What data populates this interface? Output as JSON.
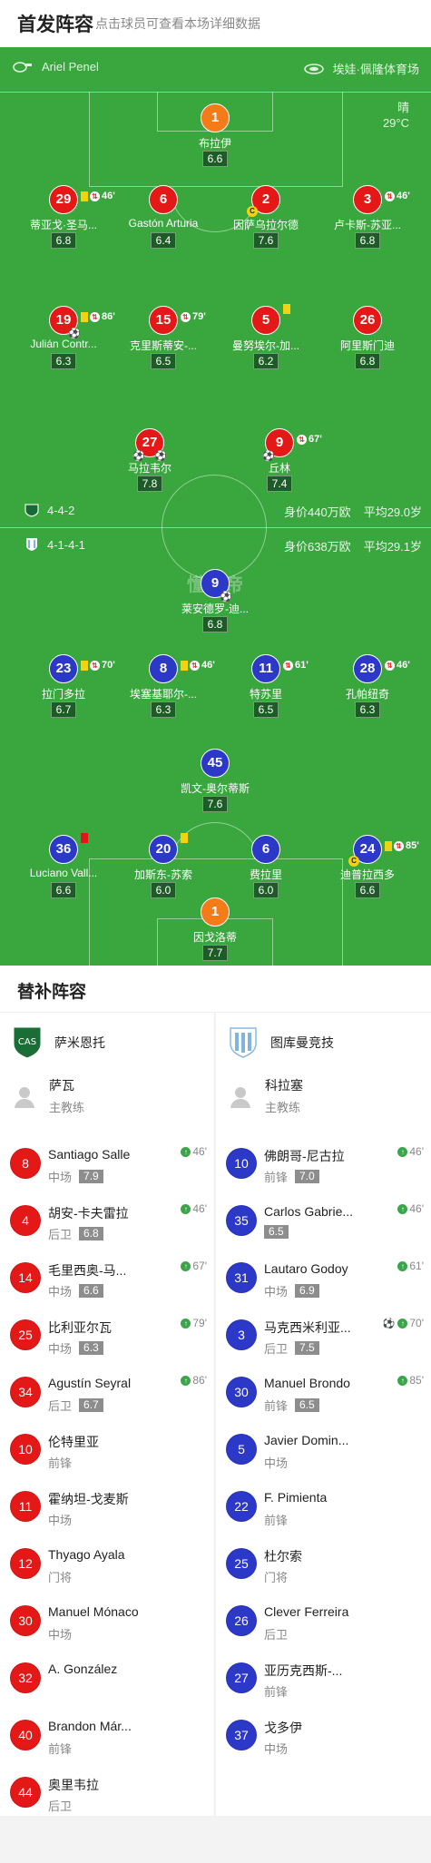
{
  "header": {
    "title": "首发阵容",
    "subtitle": "点击球员可查看本场详细数据"
  },
  "match": {
    "referee": "Ariel Penel",
    "stadium": "埃娃·佩隆体育场",
    "weather": "晴",
    "temperature": "29°C",
    "watermark": "懂球帝"
  },
  "home": {
    "formation": "4-4-2",
    "value": "身价440万欧",
    "age": "平均29.0岁",
    "players": [
      {
        "num": "1",
        "name": "布拉伊",
        "rating": "6.6",
        "color": "org"
      },
      {
        "num": "29",
        "name": "蒂亚戈·圣马...",
        "rating": "6.8",
        "color": "red",
        "yc": true,
        "sub": "46'"
      },
      {
        "num": "6",
        "name": "Gastón Arturia",
        "rating": "6.4",
        "color": "red"
      },
      {
        "num": "2",
        "name": "因萨乌拉尔德",
        "rating": "7.6",
        "color": "red",
        "cap": true
      },
      {
        "num": "3",
        "name": "卢卡斯-苏亚...",
        "rating": "6.8",
        "color": "red",
        "sub": "46'"
      },
      {
        "num": "19",
        "name": "Julián Contr...",
        "rating": "6.3",
        "color": "red",
        "yc": true,
        "sub": "86'",
        "ball2": true
      },
      {
        "num": "15",
        "name": "克里斯蒂安-...",
        "rating": "6.5",
        "color": "red",
        "sub": "79'"
      },
      {
        "num": "5",
        "name": "曼努埃尔-加...",
        "rating": "6.2",
        "color": "red",
        "yc": true
      },
      {
        "num": "26",
        "name": "阿里斯门迪",
        "rating": "6.8",
        "color": "red"
      },
      {
        "num": "27",
        "name": "马拉韦尔",
        "rating": "7.8",
        "color": "red",
        "goals": "⚽",
        "ball2": true
      },
      {
        "num": "9",
        "name": "丘林",
        "rating": "7.4",
        "color": "red",
        "sub": "67'",
        "goals": "⚽"
      }
    ]
  },
  "away": {
    "formation": "4-1-4-1",
    "value": "身价638万欧",
    "age": "平均29.1岁",
    "players": [
      {
        "num": "9",
        "name": "莱安德罗-迪...",
        "rating": "6.8",
        "color": "blu",
        "ball2": true
      },
      {
        "num": "23",
        "name": "拉门多拉",
        "rating": "6.7",
        "color": "blu",
        "yc": true,
        "sub": "70'"
      },
      {
        "num": "8",
        "name": "埃塞基耶尔-...",
        "rating": "6.3",
        "color": "blu",
        "yc": true,
        "sub": "46'"
      },
      {
        "num": "11",
        "name": "特苏里",
        "rating": "6.5",
        "color": "blu",
        "sub": "61'"
      },
      {
        "num": "28",
        "name": "孔帕纽奇",
        "rating": "6.3",
        "color": "blu",
        "sub": "46'"
      },
      {
        "num": "45",
        "name": "凯文-奥尔蒂斯",
        "rating": "7.6",
        "color": "blu"
      },
      {
        "num": "36",
        "name": "Luciano Vall...",
        "rating": "6.6",
        "color": "blu",
        "rc": true
      },
      {
        "num": "20",
        "name": "加斯东-苏索",
        "rating": "6.0",
        "color": "blu",
        "yc": true
      },
      {
        "num": "6",
        "name": "费拉里",
        "rating": "6.0",
        "color": "blu"
      },
      {
        "num": "24",
        "name": "迪普拉西多",
        "rating": "6.6",
        "color": "blu",
        "yc": true,
        "sub": "85'",
        "cap": true
      },
      {
        "num": "1",
        "name": "因戈洛蒂",
        "rating": "7.7",
        "color": "org"
      }
    ]
  },
  "subs": {
    "title": "替补阵容",
    "home": {
      "team": "萨米恩托",
      "coach": "萨瓦",
      "coach_role": "主教练",
      "players": [
        {
          "num": "8",
          "name": "Santiago Salle",
          "pos": "中场",
          "rating": "7.9",
          "min": "46'"
        },
        {
          "num": "4",
          "name": "胡安-卡夫雷拉",
          "pos": "后卫",
          "rating": "6.8",
          "min": "46'"
        },
        {
          "num": "14",
          "name": "毛里西奥-马...",
          "pos": "中场",
          "rating": "6.6",
          "min": "67'"
        },
        {
          "num": "25",
          "name": "比利亚尔瓦",
          "pos": "中场",
          "rating": "6.3",
          "min": "79'"
        },
        {
          "num": "34",
          "name": "Agustín Seyral",
          "pos": "后卫",
          "rating": "6.7",
          "min": "86'"
        },
        {
          "num": "10",
          "name": "伦特里亚",
          "pos": "前锋"
        },
        {
          "num": "11",
          "name": "霍纳坦-戈麦斯",
          "pos": "中场"
        },
        {
          "num": "12",
          "name": "Thyago Ayala",
          "pos": "门将"
        },
        {
          "num": "30",
          "name": "Manuel Mónaco",
          "pos": "中场"
        },
        {
          "num": "32",
          "name": "A. González",
          "pos": ""
        },
        {
          "num": "40",
          "name": "Brandon Már...",
          "pos": "前锋"
        },
        {
          "num": "44",
          "name": "奥里韦拉",
          "pos": "后卫"
        }
      ]
    },
    "away": {
      "team": "图库曼竞技",
      "coach": "科拉塞",
      "coach_role": "主教练",
      "players": [
        {
          "num": "10",
          "name": "佛朗哥-尼古拉",
          "pos": "前锋",
          "rating": "7.0",
          "min": "46'"
        },
        {
          "num": "35",
          "name": "Carlos Gabrie...",
          "pos": "",
          "rating": "6.5",
          "min": "46'"
        },
        {
          "num": "31",
          "name": "Lautaro Godoy",
          "pos": "中场",
          "rating": "6.9",
          "min": "61'"
        },
        {
          "num": "3",
          "name": "马克西米利亚...",
          "pos": "后卫",
          "rating": "7.5",
          "min": "70'",
          "goal": true
        },
        {
          "num": "30",
          "name": "Manuel Brondo",
          "pos": "前锋",
          "rating": "6.5",
          "min": "85'"
        },
        {
          "num": "5",
          "name": "Javier Domin...",
          "pos": "中场"
        },
        {
          "num": "22",
          "name": "F. Pimienta",
          "pos": "前锋"
        },
        {
          "num": "25",
          "name": "杜尔索",
          "pos": "门将"
        },
        {
          "num": "26",
          "name": "Clever Ferreira",
          "pos": "后卫"
        },
        {
          "num": "27",
          "name": "亚历克西斯-...",
          "pos": "前锋"
        },
        {
          "num": "37",
          "name": "戈多伊",
          "pos": "中场"
        }
      ]
    }
  },
  "colors": {
    "pitch": "#3aa63e",
    "home": "#e51818",
    "away": "#2c38c8",
    "goalkeeper": "#f47b17"
  }
}
